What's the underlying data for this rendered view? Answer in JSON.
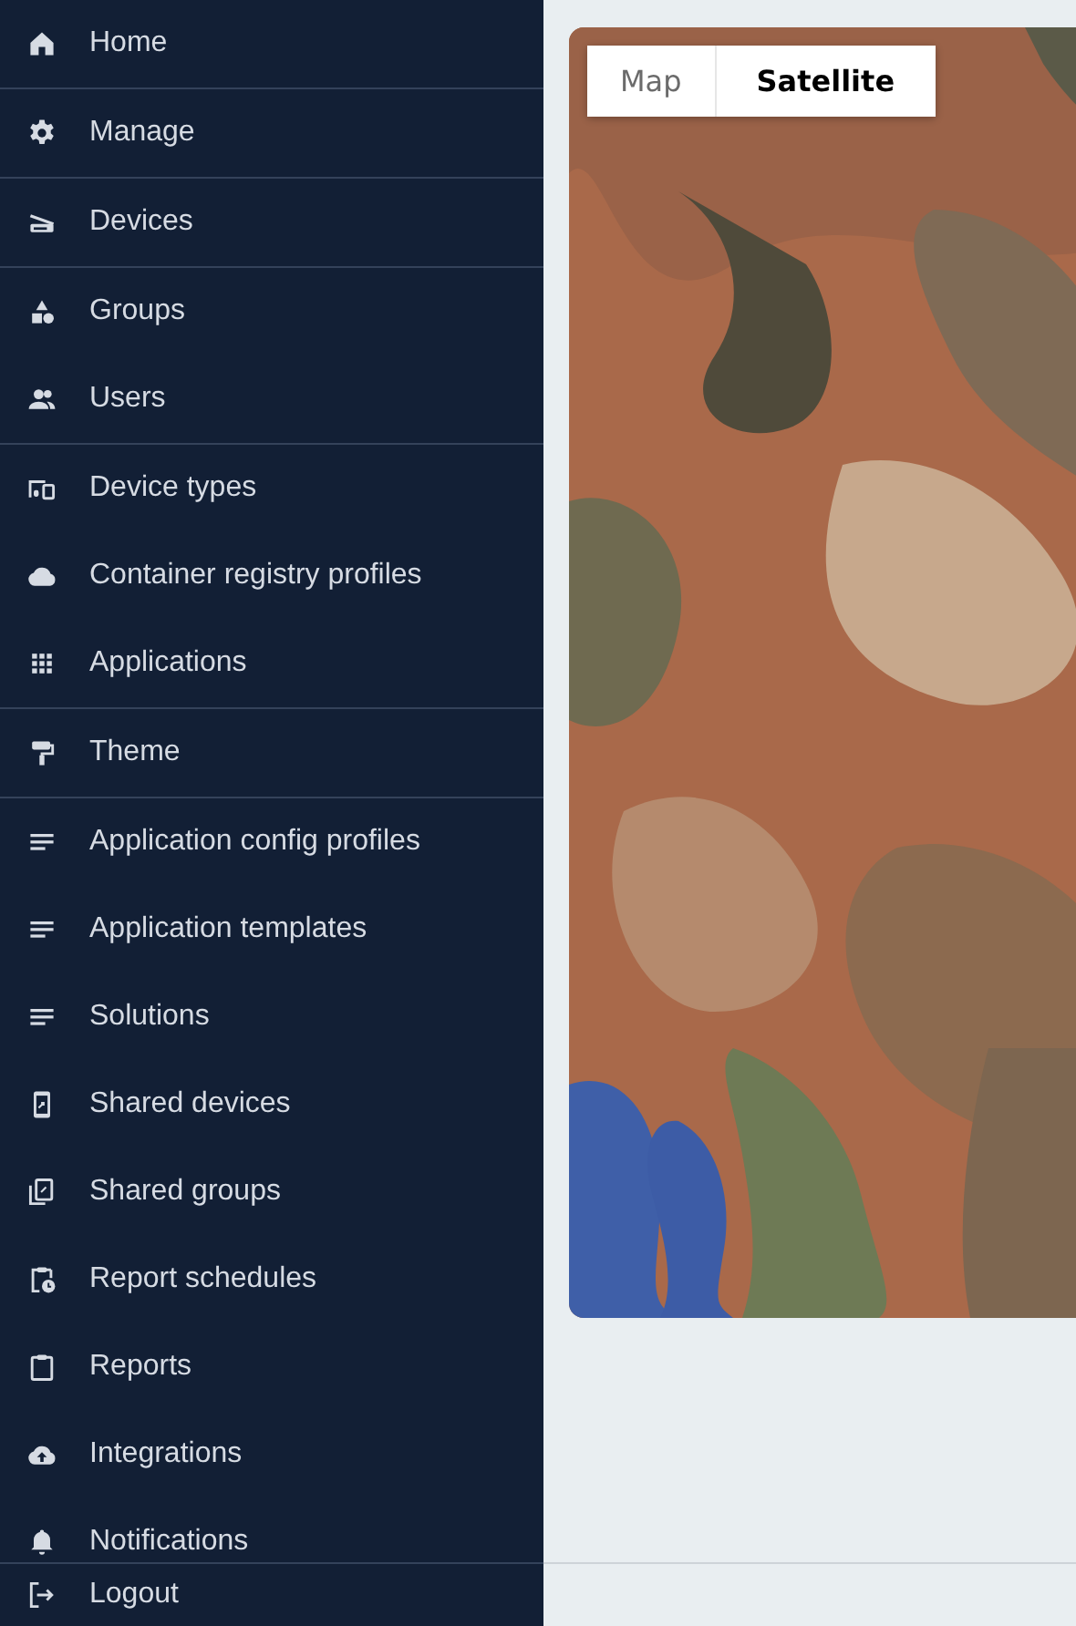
{
  "sidebar": {
    "items": [
      {
        "label": "Home",
        "divider_after": true
      },
      {
        "label": "Manage",
        "divider_after": true
      },
      {
        "label": "Devices",
        "divider_after": true
      },
      {
        "label": "Groups",
        "divider_after": false
      },
      {
        "label": "Users",
        "divider_after": true
      },
      {
        "label": "Device types",
        "divider_after": false
      },
      {
        "label": "Container registry profiles",
        "divider_after": false
      },
      {
        "label": "Applications",
        "divider_after": true
      },
      {
        "label": "Theme",
        "divider_after": true
      },
      {
        "label": "Application config profiles",
        "divider_after": false
      },
      {
        "label": "Application templates",
        "divider_after": false
      },
      {
        "label": "Solutions",
        "divider_after": false
      },
      {
        "label": "Shared devices",
        "divider_after": false
      },
      {
        "label": "Shared groups",
        "divider_after": false
      },
      {
        "label": "Report schedules",
        "divider_after": false
      },
      {
        "label": "Reports",
        "divider_after": false
      },
      {
        "label": "Integrations",
        "divider_after": false
      },
      {
        "label": "Notifications",
        "divider_after": false
      }
    ],
    "footer": {
      "label": "Logout"
    }
  },
  "map": {
    "kind": "picture",
    "map_type_toggle": [
      {
        "label": "Map",
        "selected": false
      },
      {
        "label": "Satellite",
        "selected": true
      }
    ]
  }
}
